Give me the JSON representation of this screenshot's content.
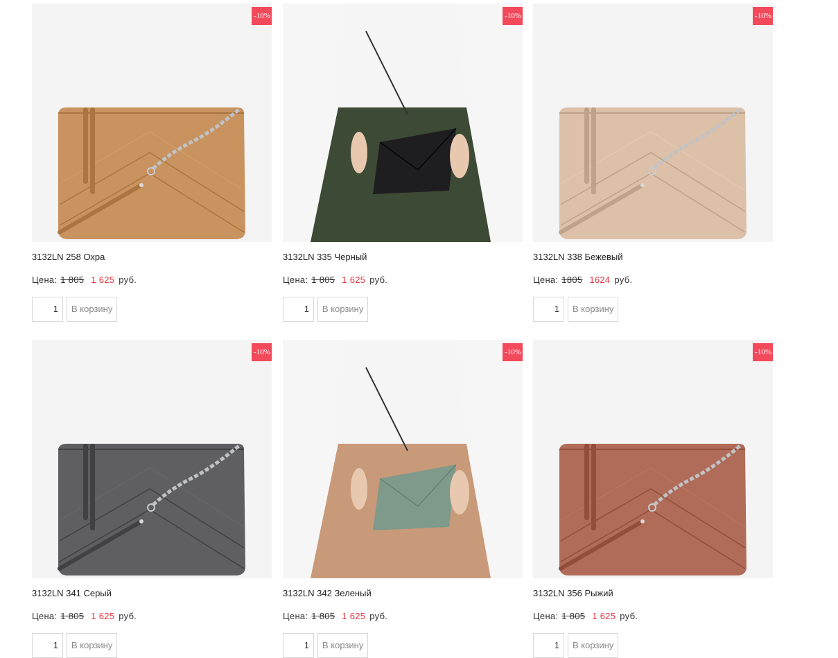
{
  "badge": "-10%",
  "price_label": "Цена:",
  "currency": "руб.",
  "cart_label": "В корзину",
  "products": [
    {
      "title": "3132LN 258 Охра",
      "old_price": "1 805",
      "new_price": "1 625",
      "qty": "1",
      "bag_color": "#c9935f",
      "photo": "bag"
    },
    {
      "title": "3132LN 335 Черный",
      "old_price": "1 805",
      "new_price": "1 625",
      "qty": "1",
      "bag_color": "#1e1e20",
      "photo": "model"
    },
    {
      "title": "3132LN 338 Бежевый",
      "old_price": "1805",
      "new_price": "1624",
      "qty": "1",
      "bag_color": "#dcc0a8",
      "photo": "bag"
    },
    {
      "title": "3132LN 341 Серый",
      "old_price": "1 805",
      "new_price": "1 625",
      "qty": "1",
      "bag_color": "#5f5e63",
      "photo": "bag"
    },
    {
      "title": "3132LN 342 Зеленый",
      "old_price": "1 805",
      "new_price": "1 625",
      "qty": "1",
      "bag_color": "#7f9a8a",
      "photo": "model"
    },
    {
      "title": "3132LN 356 Рыжий",
      "old_price": "1 805",
      "new_price": "1 625",
      "qty": "1",
      "bag_color": "#b06c58",
      "photo": "bag"
    }
  ]
}
